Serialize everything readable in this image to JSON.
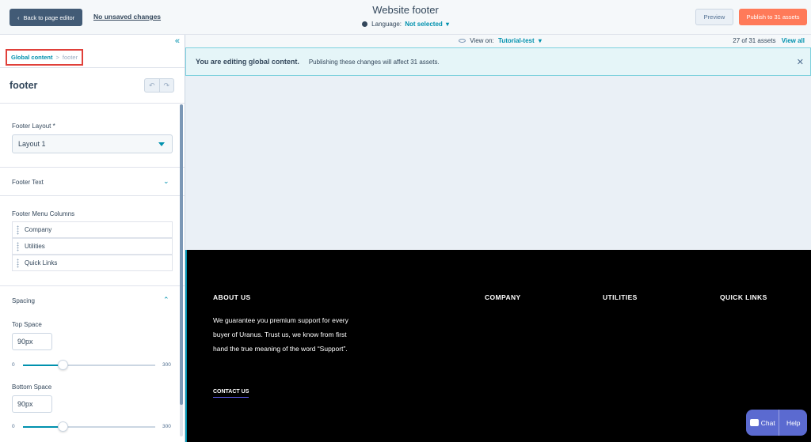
{
  "topbar": {
    "back_label": "Back to page editor",
    "unsaved_label": "No unsaved changes",
    "title": "Website footer",
    "language_label": "Language:",
    "language_value": "Not selected",
    "preview_label": "Preview",
    "publish_label": "Publish to 31 assets"
  },
  "sidebar": {
    "breadcrumb": {
      "parent": "Global content",
      "separator": ">",
      "current": "footer"
    },
    "module_name": "footer",
    "footer_layout": {
      "label": "Footer Layout *",
      "value": "Layout 1"
    },
    "footer_text_label": "Footer Text",
    "footer_menu_columns": {
      "label": "Footer Menu Columns",
      "items": [
        "Company",
        "Utilities",
        "Quick Links"
      ]
    },
    "spacing": {
      "label": "Spacing",
      "top": {
        "label": "Top Space",
        "value": "90px",
        "min": "0",
        "max": "300",
        "fraction": 0.3
      },
      "bottom": {
        "label": "Bottom Space",
        "value": "90px",
        "min": "0",
        "max": "300",
        "fraction": 0.3
      }
    }
  },
  "viewbar": {
    "view_on_label": "View on:",
    "view_on_value": "Tutorial-test",
    "assets_count": "27 of 31 assets",
    "view_all_label": "View all"
  },
  "alert": {
    "title": "You are editing global content.",
    "message": "Publishing these changes will affect 31 assets."
  },
  "footer_preview": {
    "about_heading": "ABOUT US",
    "about_text": "We guarantee you premium support for every buyer of Uranus. Trust us, we know from first hand the true meaning of the word “Support”.",
    "contact_label": "CONTACT US",
    "company_heading": "COMPANY",
    "utilities_heading": "UTILITIES",
    "quick_links_heading": "QUICK LINKS"
  },
  "chat_widget": {
    "chat_label": "Chat",
    "help_label": "Help"
  },
  "colors": {
    "primary": "#0091ae",
    "publish": "#ff7a59",
    "dark_button": "#425b76",
    "highlight": "#e0403a"
  }
}
